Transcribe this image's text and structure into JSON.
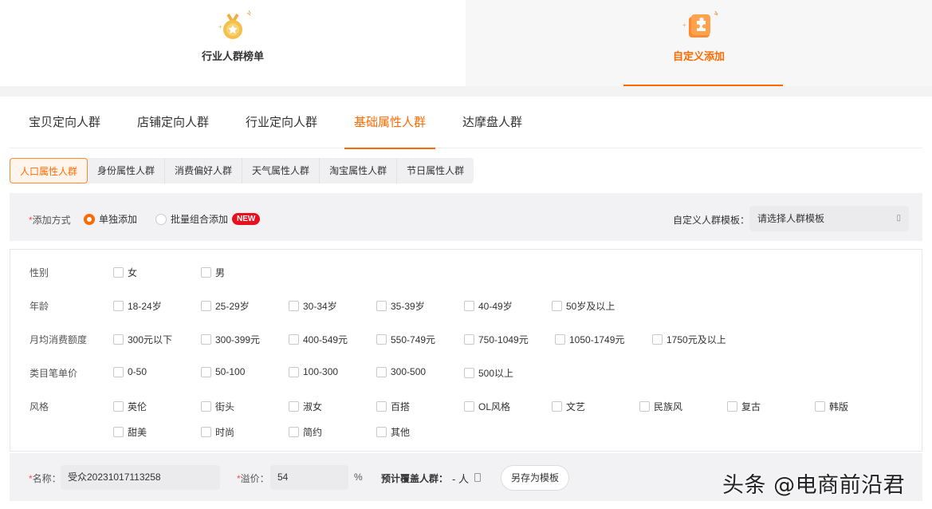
{
  "mode_tabs": [
    {
      "label": "行业人群榜单",
      "icon": "medal-icon",
      "active": false
    },
    {
      "label": "自定义添加",
      "icon": "puzzle-icon",
      "active": true
    }
  ],
  "category_tabs": [
    "宝贝定向人群",
    "店铺定向人群",
    "行业定向人群",
    "基础属性人群",
    "达摩盘人群"
  ],
  "sub_tabs": [
    "人口属性人群",
    "身份属性人群",
    "消费偏好人群",
    "天气属性人群",
    "淘宝属性人群",
    "节日属性人群"
  ],
  "method": {
    "required_mark": "*",
    "label": "添加方式",
    "options": [
      "单独添加",
      "批量组合添加"
    ],
    "badge": "NEW",
    "template_label": "自定义人群模板：",
    "template_placeholder": "请选择人群模板",
    "caret": "▯"
  },
  "attributes": {
    "gender": {
      "label": "性别",
      "options": [
        "女",
        "男"
      ]
    },
    "age": {
      "label": "年龄",
      "options": [
        "18-24岁",
        "25-29岁",
        "30-34岁",
        "35-39岁",
        "40-49岁",
        "50岁及以上"
      ]
    },
    "spend": {
      "label": "月均消费额度",
      "options": [
        "300元以下",
        "300-399元",
        "400-549元",
        "550-749元",
        "750-1049元",
        "1050-1749元",
        "1750元及以上"
      ]
    },
    "price": {
      "label": "类目笔单价",
      "options": [
        "0-50",
        "50-100",
        "100-300",
        "300-500",
        "500以上"
      ]
    },
    "style": {
      "label": "风格",
      "options": [
        "英伦",
        "街头",
        "淑女",
        "百搭",
        "OL风格",
        "文艺",
        "民族风",
        "复古",
        "韩版",
        "甜美",
        "时尚",
        "简约",
        "其他"
      ]
    }
  },
  "form": {
    "required_mark": "*",
    "name_label": "名称：",
    "name_value": "受众20231017113258",
    "premium_label": "溢价：",
    "premium_value": "54",
    "premium_unit": "%",
    "coverage_label": "预计覆盖人群：",
    "coverage_value": "- 人",
    "save_template": "另存为模板"
  },
  "watermark": "头条 @电商前沿君",
  "colors": {
    "accent": "#ff6a00",
    "badge": "#e8101c"
  }
}
